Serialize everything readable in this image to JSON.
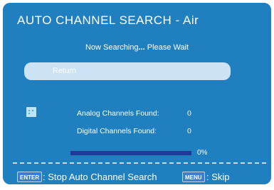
{
  "title": "AUTO CHANNEL SEARCH - Air",
  "status": {
    "text": "Now Searching",
    "ellipsis": "...",
    "suffix": " Please Wait"
  },
  "return_button": {
    "label": "Return"
  },
  "icons": {
    "status": "status-indicator-icon"
  },
  "analog": {
    "label": "Analog Channels Found:",
    "value": "0"
  },
  "digital": {
    "label": "Digital Channels Found:",
    "value": "0"
  },
  "progress": {
    "fraction": 0,
    "text": "0%"
  },
  "footer": {
    "enter_key": "ENTER",
    "enter_hint": ": Stop Auto Channel Search",
    "menu_key": "MENU",
    "menu_hint": ": Skip"
  },
  "colors": {
    "background": "#1f7fbf",
    "button": "#cbe3f4",
    "progress": "#1f3a9c",
    "key": "#3a7ed6"
  }
}
